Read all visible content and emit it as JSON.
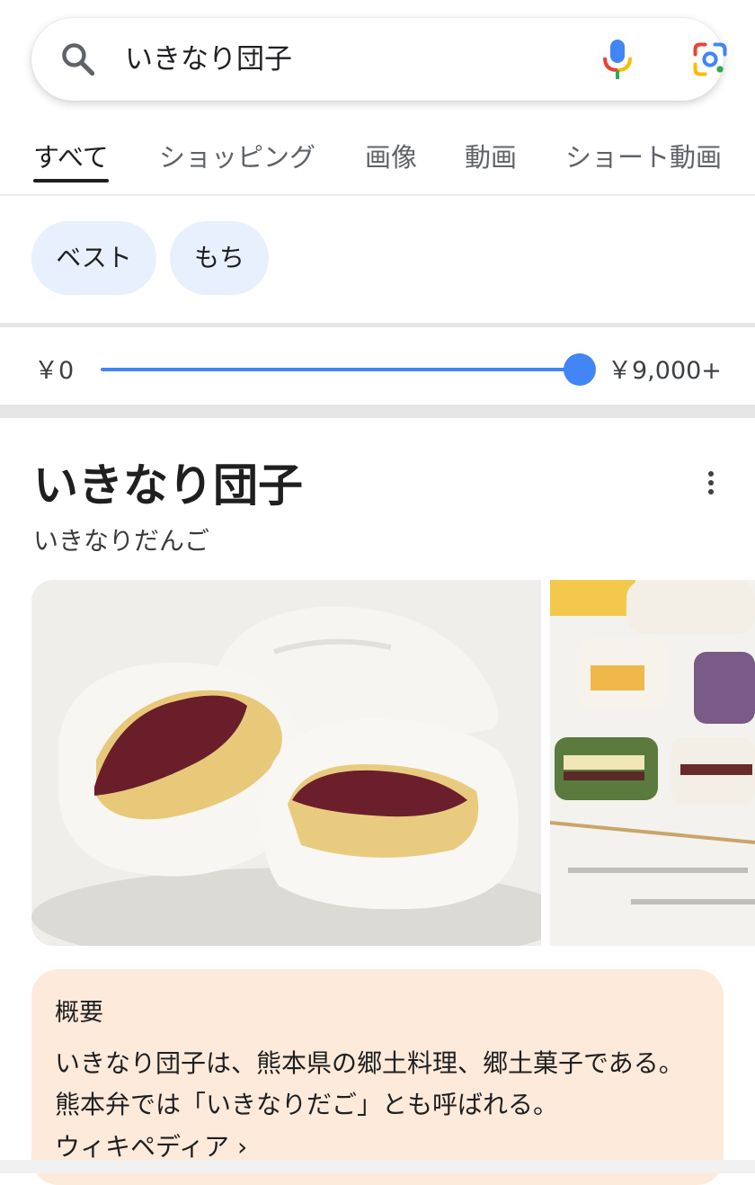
{
  "search": {
    "query": "いきなり団子"
  },
  "icons": {
    "search": "search-icon",
    "mic": "microphone-icon",
    "lens": "google-lens-icon",
    "more": "more-vert-icon",
    "chevron": "chevron-right-icon"
  },
  "tabs": [
    {
      "label": "すべて",
      "active": true
    },
    {
      "label": "ショッピング"
    },
    {
      "label": "画像"
    },
    {
      "label": "動画"
    },
    {
      "label": "ショート動画"
    }
  ],
  "chips": [
    {
      "label": "ベスト"
    },
    {
      "label": "もち"
    }
  ],
  "price_filter": {
    "min_label": "￥0",
    "max_label": "￥9,000+",
    "selected_fraction": 1.0
  },
  "knowledge_panel": {
    "title": "いきなり団子",
    "reading": "いきなりだんご",
    "overview": {
      "heading": "概要",
      "text": "いきなり団子は、熊本県の郷土料理、郷土菓子である。 熊本弁では「いきなりだご」とも呼ばれる。",
      "link": "ウィキペディア ›"
    }
  },
  "colors": {
    "accent": "#4285f4",
    "chip_bg": "#e8f0fe",
    "overview_bg": "#fdeadb"
  }
}
